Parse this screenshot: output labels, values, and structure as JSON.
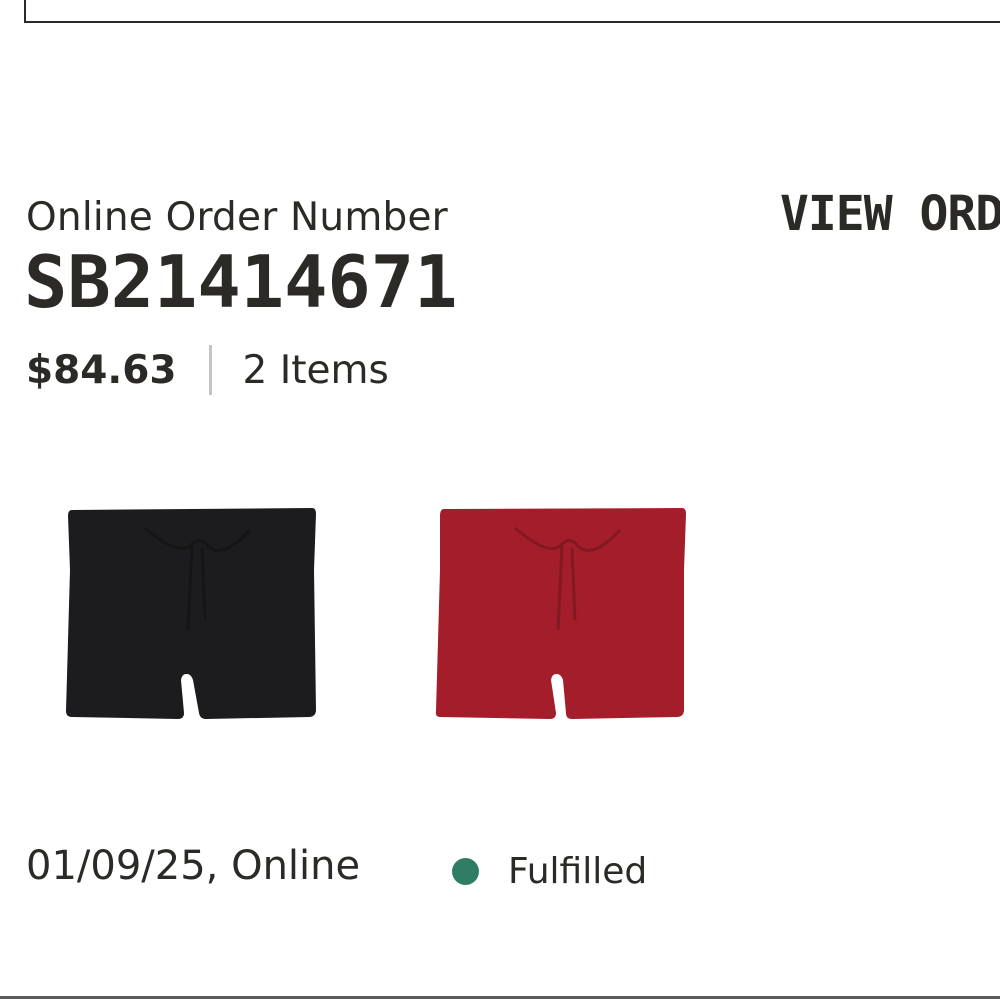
{
  "order": {
    "label": "Online Order Number",
    "number": "SB21414671",
    "total": "$84.63",
    "items_count": "2 Items",
    "view_order_label": "VIEW ORD",
    "date_channel": "01/09/25, Online",
    "status": "Fulfilled",
    "status_color": "#2e7d64"
  },
  "products": [
    {
      "icon": "shorts-icon",
      "color": "#1c1c1e"
    },
    {
      "icon": "shorts-icon",
      "color": "#a31e2a"
    }
  ]
}
